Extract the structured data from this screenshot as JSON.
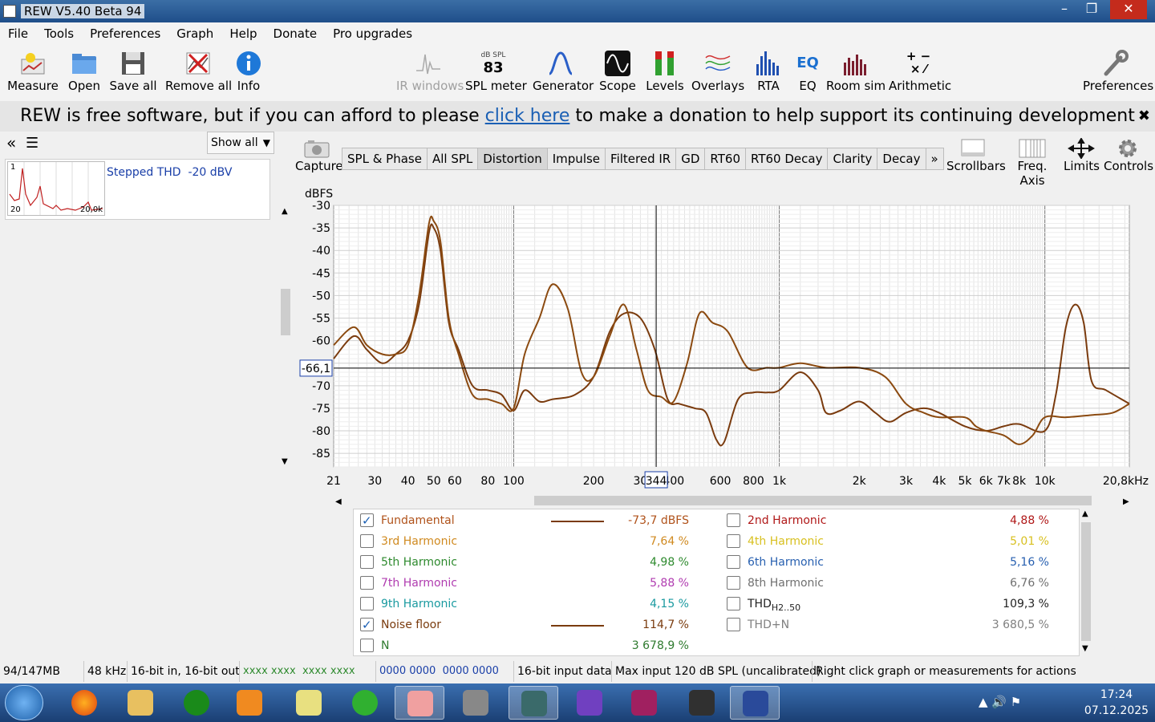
{
  "window": {
    "title": "REW V5.40 Beta 94",
    "minimize": "–",
    "maximize": "❐",
    "close": "✕"
  },
  "menu": [
    "File",
    "Tools",
    "Preferences",
    "Graph",
    "Help",
    "Donate",
    "Pro upgrades"
  ],
  "toolbar": {
    "left": [
      {
        "label": "Measure",
        "icon": "measure-icon"
      },
      {
        "label": "Open",
        "icon": "folder-icon"
      },
      {
        "label": "Save all",
        "icon": "save-icon"
      },
      {
        "label": "Remove all",
        "icon": "remove-icon"
      },
      {
        "label": "Info",
        "icon": "info-icon"
      }
    ],
    "center": [
      {
        "label": "IR windows",
        "icon": "ir-windows-icon",
        "disabled": true
      },
      {
        "label": "SPL meter",
        "icon": "spl-meter-icon",
        "badge_top": "dB SPL",
        "badge_value": "83"
      },
      {
        "label": "Generator",
        "icon": "generator-icon"
      },
      {
        "label": "Scope",
        "icon": "scope-icon"
      },
      {
        "label": "Levels",
        "icon": "levels-icon"
      },
      {
        "label": "Overlays",
        "icon": "overlays-icon"
      },
      {
        "label": "RTA",
        "icon": "rta-icon"
      },
      {
        "label": "EQ",
        "icon": "eq-icon"
      },
      {
        "label": "Room sim",
        "icon": "room-sim-icon"
      },
      {
        "label": "Arithmetic",
        "icon": "arithmetic-icon"
      }
    ],
    "right": {
      "label": "Preferences",
      "icon": "wrench-icon"
    }
  },
  "banner": {
    "prefix": "REW is free software, but if you can afford to please ",
    "link": "click here",
    "suffix": " to make a donation to help support its continuing development",
    "close": "✖"
  },
  "leftpanel": {
    "collapse": "«",
    "menu": "☰",
    "show_all": "Show all",
    "measurement": {
      "name": "Stepped THD  -20 dBV",
      "thumb_top": "1",
      "thumb_left": "20",
      "thumb_right": "20,0k"
    }
  },
  "capture": "Capture",
  "tabs": [
    "SPL & Phase",
    "All SPL",
    "Distortion",
    "Impulse",
    "Filtered IR",
    "GD",
    "RT60",
    "RT60 Decay",
    "Clarity",
    "Decay",
    "»"
  ],
  "active_tab": "Distortion",
  "right_buttons": [
    {
      "label": "Scrollbars",
      "icon": "scrollbars-icon"
    },
    {
      "label": "Freq. Axis",
      "icon": "freq-axis-icon"
    },
    {
      "label": "Limits",
      "icon": "limits-icon"
    },
    {
      "label": "Controls",
      "icon": "gear-icon"
    }
  ],
  "chart_data": {
    "type": "line",
    "ylabel": "dBFS",
    "ylim": [
      -88,
      -30
    ],
    "yticks": [
      -30,
      -35,
      -40,
      -45,
      -50,
      -55,
      -60,
      -70,
      -75,
      -80,
      -85
    ],
    "xscale": "log",
    "xlim": [
      21,
      20800
    ],
    "xticks": [
      {
        "v": 21,
        "t": "21"
      },
      {
        "v": 30,
        "t": "30"
      },
      {
        "v": 40,
        "t": "40"
      },
      {
        "v": 50,
        "t": "50"
      },
      {
        "v": 60,
        "t": "60"
      },
      {
        "v": 80,
        "t": "80"
      },
      {
        "v": 100,
        "t": "100"
      },
      {
        "v": 200,
        "t": "200"
      },
      {
        "v": 300,
        "t": "30"
      },
      {
        "v": 400,
        "t": "400"
      },
      {
        "v": 600,
        "t": "600"
      },
      {
        "v": 800,
        "t": "800"
      },
      {
        "v": 1000,
        "t": "1k"
      },
      {
        "v": 2000,
        "t": "2k"
      },
      {
        "v": 3000,
        "t": "3k"
      },
      {
        "v": 4000,
        "t": "4k"
      },
      {
        "v": 5000,
        "t": "5k"
      },
      {
        "v": 6000,
        "t": "6k"
      },
      {
        "v": 7000,
        "t": "7k"
      },
      {
        "v": 8000,
        "t": "8k"
      },
      {
        "v": 10000,
        "t": "10k"
      },
      {
        "v": 20800,
        "t": "20,8kHz"
      }
    ],
    "cursor": {
      "x": 344,
      "x_label": "344",
      "y": -66.1,
      "y_label": "-66,1"
    },
    "grid": true,
    "series": [
      {
        "name": "Fundamental",
        "color": "#7a3b0e",
        "points": [
          [
            21,
            -64
          ],
          [
            25,
            -59
          ],
          [
            28,
            -62
          ],
          [
            32,
            -65
          ],
          [
            36,
            -63
          ],
          [
            40,
            -60
          ],
          [
            44,
            -52
          ],
          [
            48,
            -36
          ],
          [
            50,
            -35
          ],
          [
            53,
            -40
          ],
          [
            57,
            -56
          ],
          [
            62,
            -62
          ],
          [
            70,
            -70
          ],
          [
            80,
            -71
          ],
          [
            90,
            -72
          ],
          [
            100,
            -75.5
          ],
          [
            110,
            -71
          ],
          [
            125,
            -73.5
          ],
          [
            140,
            -73
          ],
          [
            170,
            -72
          ],
          [
            200,
            -68
          ],
          [
            230,
            -58
          ],
          [
            260,
            -54
          ],
          [
            300,
            -55
          ],
          [
            340,
            -62
          ],
          [
            380,
            -73
          ],
          [
            420,
            -74
          ],
          [
            480,
            -75
          ],
          [
            530,
            -76
          ],
          [
            580,
            -82
          ],
          [
            620,
            -82.5
          ],
          [
            700,
            -73
          ],
          [
            800,
            -71.5
          ],
          [
            900,
            -71.5
          ],
          [
            1000,
            -71
          ],
          [
            1200,
            -67
          ],
          [
            1400,
            -71
          ],
          [
            1500,
            -76
          ],
          [
            1700,
            -75.5
          ],
          [
            2000,
            -73.5
          ],
          [
            2300,
            -76
          ],
          [
            2600,
            -78
          ],
          [
            3000,
            -76
          ],
          [
            3500,
            -75
          ],
          [
            4000,
            -76
          ],
          [
            5000,
            -79
          ],
          [
            6000,
            -80
          ],
          [
            7000,
            -79
          ],
          [
            8000,
            -78.5
          ],
          [
            10000,
            -80
          ],
          [
            11000,
            -72
          ],
          [
            12000,
            -57
          ],
          [
            13000,
            -52
          ],
          [
            14000,
            -56
          ],
          [
            15000,
            -69
          ],
          [
            17000,
            -71
          ],
          [
            20800,
            -74
          ]
        ]
      },
      {
        "name": "Noise floor",
        "color": "#8b4a10",
        "points": [
          [
            21,
            -61
          ],
          [
            25,
            -57
          ],
          [
            28,
            -61
          ],
          [
            32,
            -63
          ],
          [
            36,
            -63
          ],
          [
            40,
            -61
          ],
          [
            44,
            -50
          ],
          [
            48,
            -34
          ],
          [
            50,
            -33.5
          ],
          [
            53,
            -38
          ],
          [
            57,
            -55
          ],
          [
            62,
            -63
          ],
          [
            70,
            -72
          ],
          [
            80,
            -73
          ],
          [
            90,
            -74
          ],
          [
            100,
            -75
          ],
          [
            110,
            -63
          ],
          [
            125,
            -55
          ],
          [
            140,
            -47.5
          ],
          [
            160,
            -53
          ],
          [
            180,
            -67
          ],
          [
            200,
            -68
          ],
          [
            230,
            -59
          ],
          [
            260,
            -52
          ],
          [
            290,
            -62
          ],
          [
            320,
            -71
          ],
          [
            360,
            -72.5
          ],
          [
            400,
            -73.5
          ],
          [
            450,
            -65
          ],
          [
            500,
            -54
          ],
          [
            560,
            -56
          ],
          [
            640,
            -58
          ],
          [
            760,
            -66
          ],
          [
            900,
            -66
          ],
          [
            1000,
            -66
          ],
          [
            1200,
            -65
          ],
          [
            1500,
            -66
          ],
          [
            2000,
            -66
          ],
          [
            2500,
            -68
          ],
          [
            3000,
            -74
          ],
          [
            3500,
            -76
          ],
          [
            4000,
            -77
          ],
          [
            5000,
            -77
          ],
          [
            5500,
            -79
          ],
          [
            6000,
            -80
          ],
          [
            7000,
            -81
          ],
          [
            8000,
            -83
          ],
          [
            9000,
            -81
          ],
          [
            10000,
            -77
          ],
          [
            12000,
            -77
          ],
          [
            15000,
            -76.5
          ],
          [
            18000,
            -76
          ],
          [
            20800,
            -74
          ]
        ]
      }
    ]
  },
  "legend": [
    {
      "name": "Fundamental",
      "value": "-73,7 dBFS",
      "checked": true,
      "color": "#b0521a",
      "line": true
    },
    {
      "name": "2nd Harmonic",
      "value": "4,88 %",
      "checked": false,
      "color": "#b01818"
    },
    {
      "name": "3rd Harmonic",
      "value": "7,64 %",
      "checked": false,
      "color": "#d08a20"
    },
    {
      "name": "4th Harmonic",
      "value": "5,01 %",
      "checked": false,
      "color": "#d8c020"
    },
    {
      "name": "5th Harmonic",
      "value": "4,98 %",
      "checked": false,
      "color": "#2e8a2e"
    },
    {
      "name": "6th Harmonic",
      "value": "5,16 %",
      "checked": false,
      "color": "#2860b0"
    },
    {
      "name": "7th Harmonic",
      "value": "5,88 %",
      "checked": false,
      "color": "#b03cb0"
    },
    {
      "name": "8th Harmonic",
      "value": "6,76 %",
      "checked": false,
      "color": "#707070"
    },
    {
      "name": "9th Harmonic",
      "value": "4,15 %",
      "checked": false,
      "color": "#1a9aa0"
    },
    {
      "name": "THD",
      "sub": "H2..50",
      "value": "109,3 %",
      "checked": false,
      "color": "#222222"
    },
    {
      "name": "Noise floor",
      "value": "114,7 %",
      "checked": true,
      "color": "#7a3b0e",
      "line": true
    },
    {
      "name": "THD+N",
      "value": "3 680,5 %",
      "checked": false,
      "color": "#808080"
    },
    {
      "name": "N",
      "value": "3 678,9 %",
      "checked": false,
      "color": "#2e7a2e"
    }
  ],
  "status": [
    "94/147MB",
    "48 kHz",
    "16-bit in, 16-bit out",
    "xxxx xxxx  xxxx xxxx",
    "0000 0000  0000 0000",
    "16-bit input data",
    "Max input 120 dB SPL (uncalibrated)",
    "Right click graph or measurements for actions"
  ],
  "clock": {
    "time": "17:24",
    "date": "07.12.2025"
  },
  "tray": "▲  🔊  ⚑"
}
